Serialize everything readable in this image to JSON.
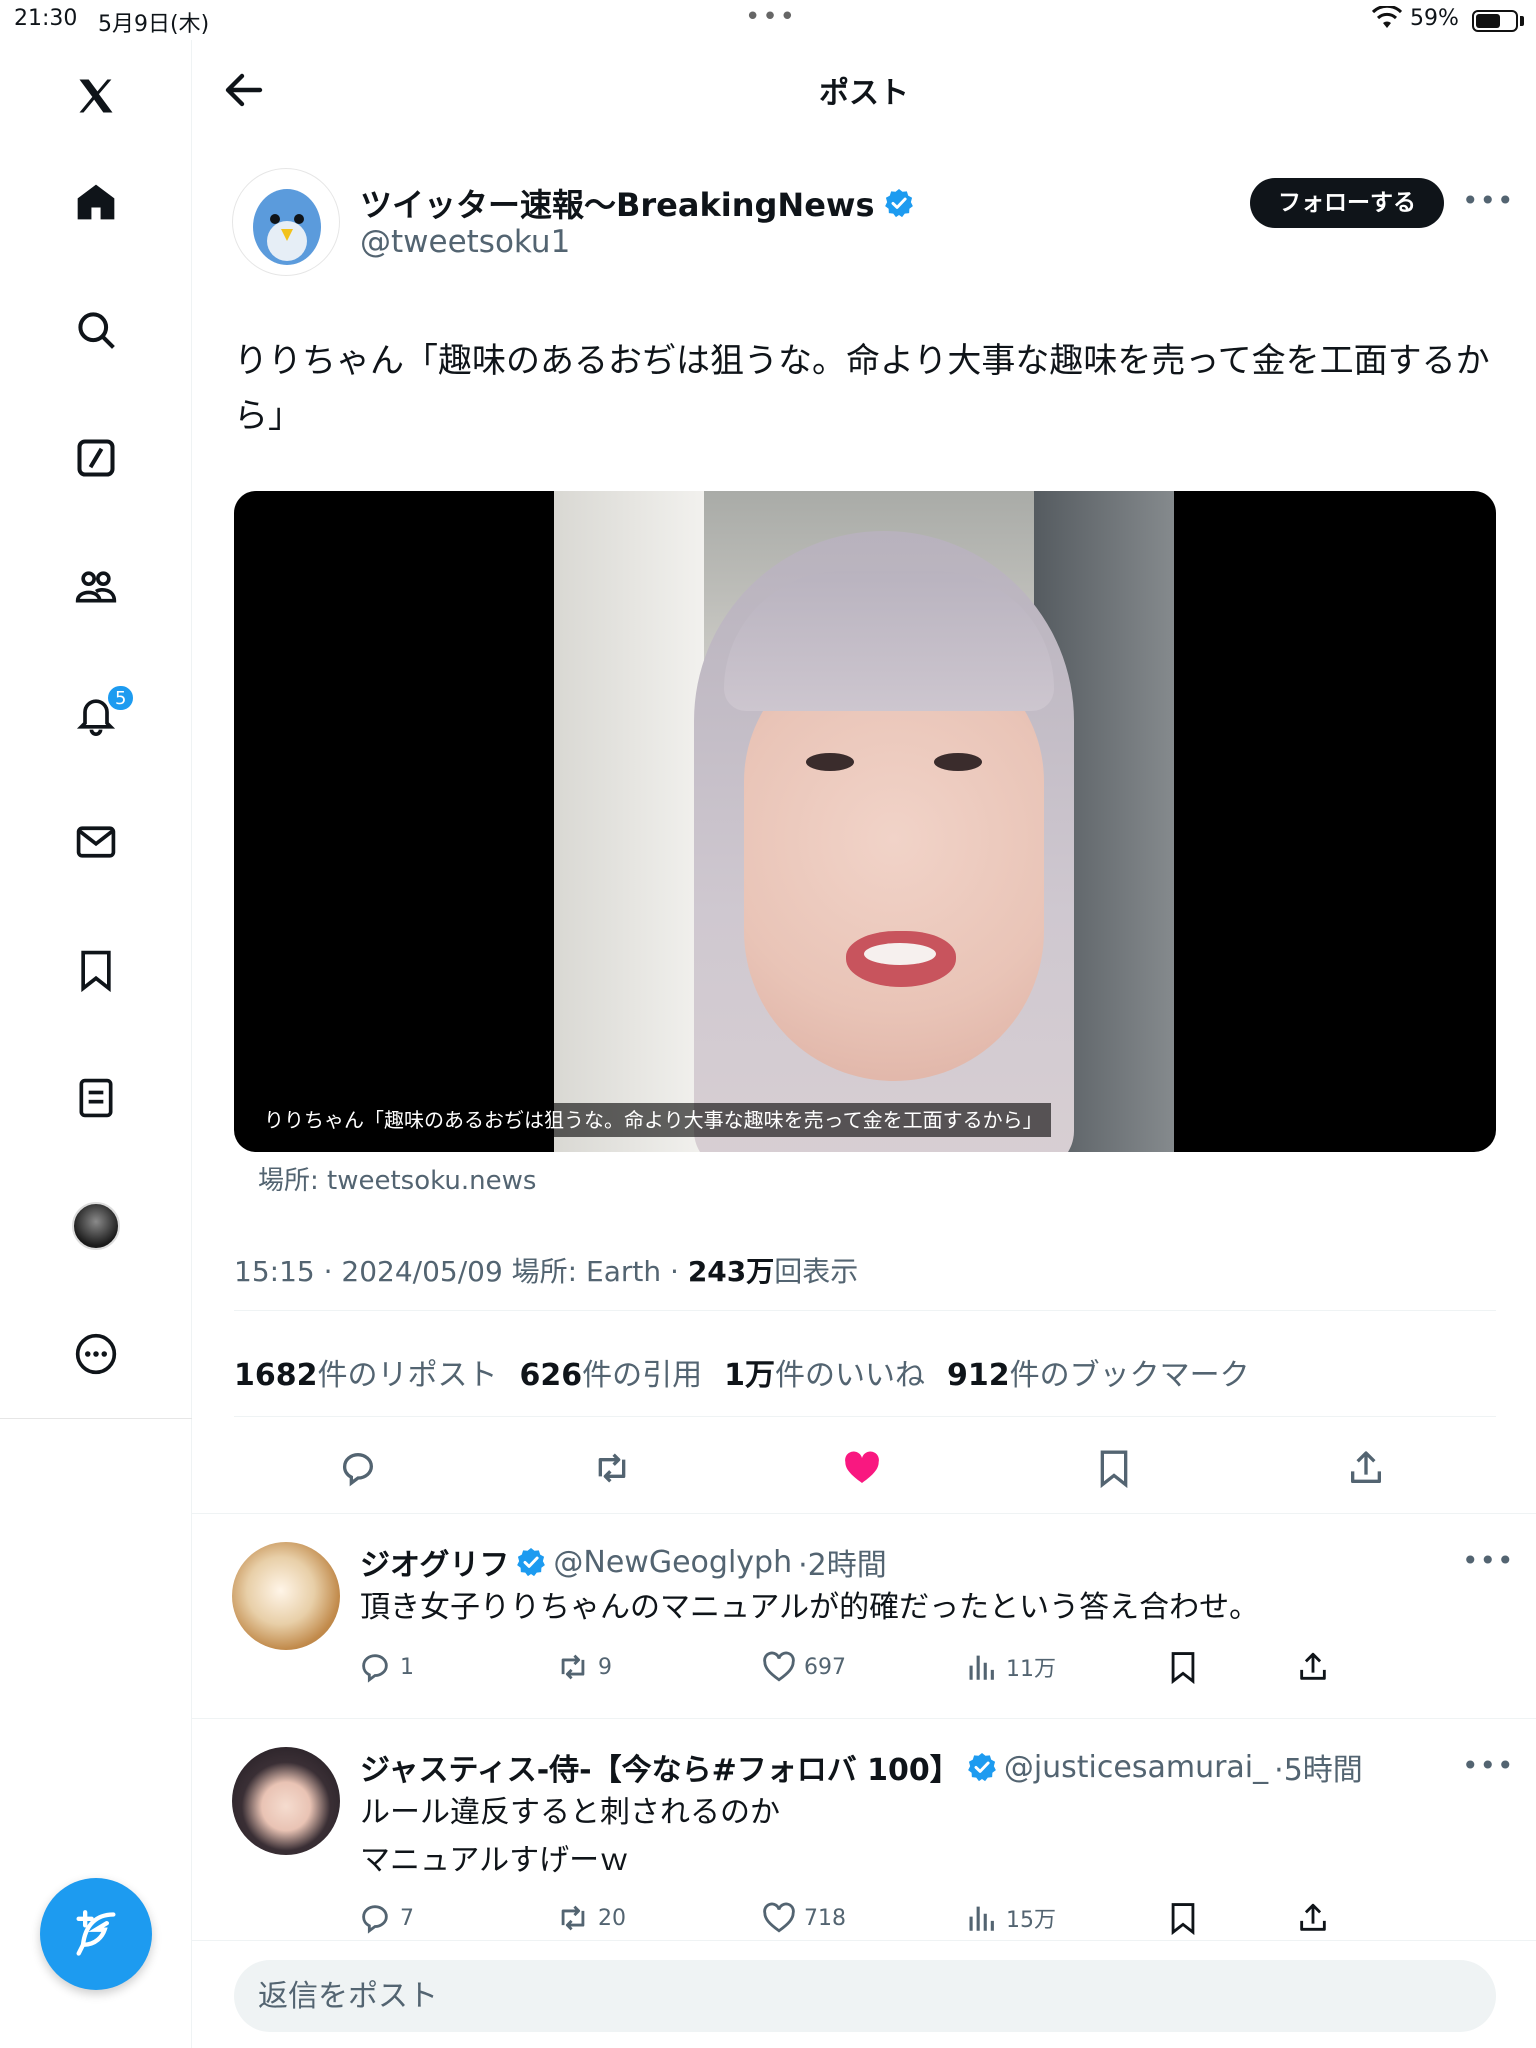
{
  "status_bar": {
    "time": "21:30",
    "date": "5月9日(木)",
    "battery": "59%"
  },
  "sidebar": {
    "notification_count": "5"
  },
  "header": {
    "title": "ポスト"
  },
  "post": {
    "author_name": "ツイッター速報〜BreakingNews",
    "handle": "@tweetsoku1",
    "follow_label": "フォローする",
    "text": "りりちゃん「趣味のあるおぢは狙うな。命より大事な趣味を売って金を工面するから」",
    "media_caption": "りりちゃん「趣味のあるおぢは狙うな。命より大事な趣味を売って金を工面するから」",
    "media_source": "場所: tweetsoku.news",
    "meta_prefix": "15:15 · 2024/05/09 場所: Earth · ",
    "views_value": "243万",
    "views_suffix": "回表示",
    "stats": [
      {
        "value": "1682",
        "label": "件のリポスト"
      },
      {
        "value": "626",
        "label": "件の引用"
      },
      {
        "value": "1万",
        "label": "件のいいね"
      },
      {
        "value": "912",
        "label": "件のブックマーク"
      }
    ],
    "liked": true
  },
  "replies": [
    {
      "name": "ジオグリフ",
      "handle": "@NewGeoglyph",
      "time": "·2時間",
      "lines": [
        "頂き女子りりちゃんのマニュアルが的確だったという答え合わせ。"
      ],
      "replies": "1",
      "reposts": "9",
      "likes": "697",
      "views": "11万"
    },
    {
      "name": "ジャスティス-侍-【今なら#フォロバ 100】",
      "handle": "@justicesamurai_",
      "time": "·5時間",
      "lines": [
        "ルール違反すると刺されるのか",
        "マニュアルすげーｗ"
      ],
      "replies": "7",
      "reposts": "20",
      "likes": "718",
      "views": "15万"
    }
  ],
  "reply_bar": {
    "placeholder": "返信をポスト"
  },
  "colors": {
    "accent": "#1d9bf0",
    "like": "#f91880",
    "text": "#0f1419",
    "muted": "#536471"
  },
  "icons": [
    "x-logo-icon",
    "home-icon",
    "search-icon",
    "grok-icon",
    "communities-icon",
    "bell-icon",
    "mail-icon",
    "bookmark-icon",
    "lists-icon",
    "more-circle-icon",
    "compose-icon",
    "back-arrow-icon",
    "verified-icon",
    "reply-icon",
    "repost-icon",
    "heart-icon",
    "bookmark-icon",
    "share-icon",
    "views-icon"
  ]
}
